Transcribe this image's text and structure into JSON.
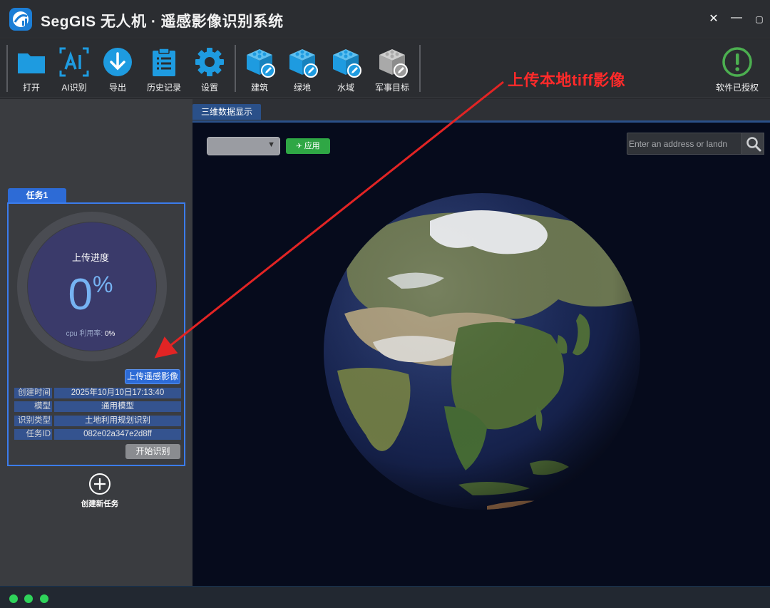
{
  "window": {
    "title": "SegGIS 无人机 · 遥感影像识别系统",
    "controls": {
      "close": "✕",
      "minimize": "—",
      "maximize": "▢"
    }
  },
  "toolbar": {
    "open": "打开",
    "ai": "AI识别",
    "export": "导出",
    "history": "历史记录",
    "settings": "设置",
    "building": "建筑",
    "green": "绿地",
    "water": "水域",
    "military": "军事目标",
    "license": "软件已授权"
  },
  "task": {
    "tab": "任务1",
    "progress_title": "上传进度",
    "progress_value": "0",
    "progress_unit": "%",
    "cpu_label": "cpu 利用率:",
    "cpu_value": "0%",
    "upload_button": "上传遥感影像",
    "info": [
      {
        "key": "创建时间",
        "value": "2025年10月10日17:13:40"
      },
      {
        "key": "模型",
        "value": "通用模型"
      },
      {
        "key": "识别类型",
        "value": "土地利用规划识别"
      },
      {
        "key": "任务ID",
        "value": "082e02a347e2d8ff"
      }
    ],
    "start_button": "开始识别"
  },
  "new_task": {
    "label": "创建新任务"
  },
  "main": {
    "tab": "三维数据显示",
    "apply_button": "应用",
    "search_placeholder": "Enter an address or landn"
  },
  "annotation": {
    "text": "上传本地tiff影像",
    "color": "#ff2a2a"
  },
  "colors": {
    "accent": "#2d6bd6",
    "tool_blue": "#1e9be0",
    "status_green": "#2fd35a",
    "license_green": "#4caf50"
  },
  "icons": {
    "open": "folder-icon",
    "ai": "ai-recognition-icon",
    "export": "download-icon",
    "history": "clipboard-icon",
    "settings": "gear-icon",
    "building": "cube-edit-icon",
    "license": "exclamation-circle-icon",
    "search": "search-icon",
    "new_task": "plus-circle-icon"
  }
}
